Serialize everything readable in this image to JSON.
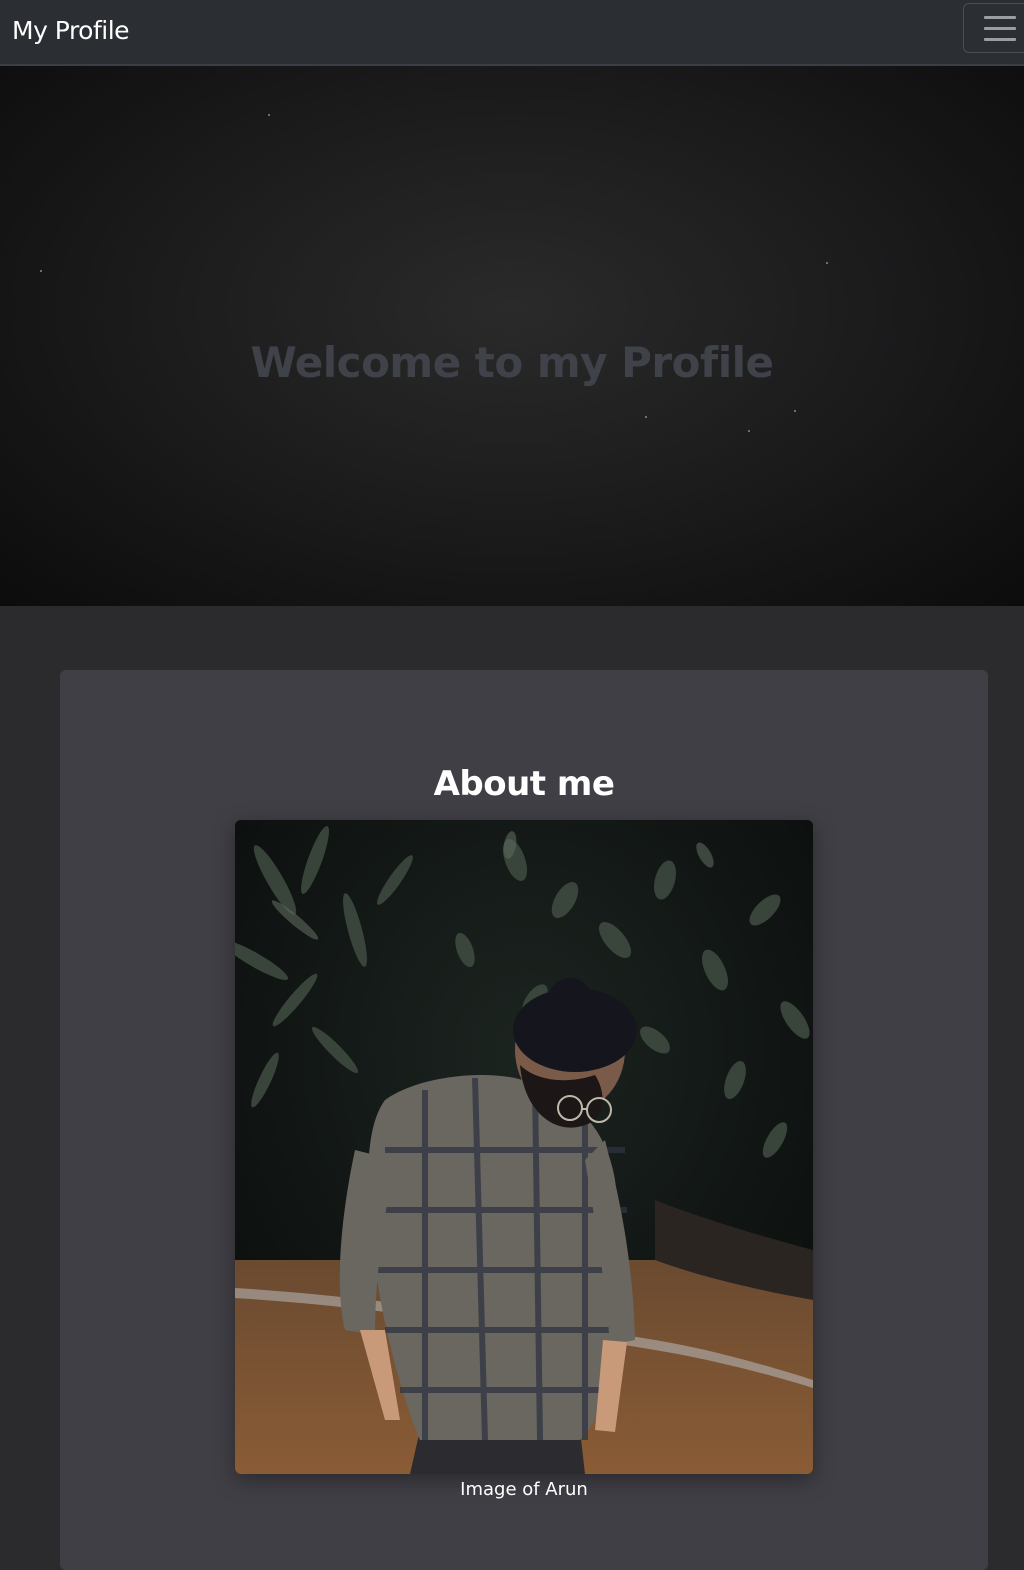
{
  "navbar": {
    "brand": "My Profile",
    "menu_icon": "hamburger-menu-icon"
  },
  "hero": {
    "title": "Welcome to my Profile"
  },
  "about": {
    "title": "About me",
    "photo_caption": "Image of Arun"
  },
  "colors": {
    "navbar_bg": "#2b2f34",
    "page_bg": "#2b2b2d",
    "card_bg": "#403f45",
    "hero_title": "#3f4248",
    "text": "#ffffff"
  }
}
